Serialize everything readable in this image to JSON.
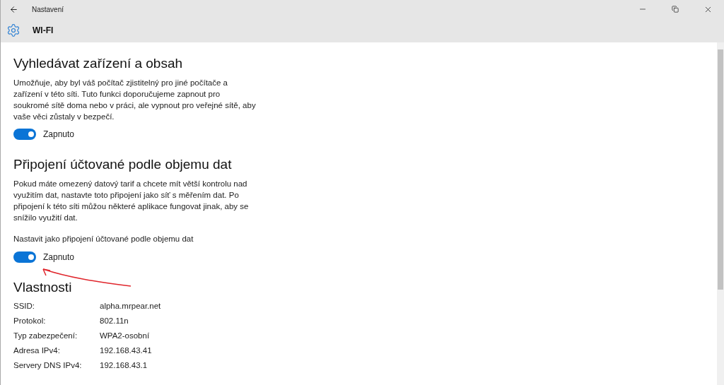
{
  "window": {
    "title": "Nastavení"
  },
  "header": {
    "title": "WI-FI"
  },
  "sections": [
    {
      "heading": "Vyhledávat zařízení a obsah",
      "description": "Umožňuje, aby byl váš počítač zjistitelný pro jiné počítače a zařízení v této síti. Tuto funkci doporučujeme zapnout pro soukromé sítě doma nebo v práci, ale vypnout pro veřejné sítě, aby vaše věci zůstaly v bezpečí.",
      "toggle": {
        "on": true,
        "text": "Zapnuto"
      }
    },
    {
      "heading": "Připojení účtované podle objemu dat",
      "description": "Pokud máte omezený datový tarif a chcete mít větší kontrolu nad využitím dat, nastavte toto připojení jako síť s měřením dat. Po připojení k této síti můžou některé aplikace fungovat jinak, aby se snížilo využití dat.",
      "label": "Nastavit jako připojení účtované podle objemu dat",
      "toggle": {
        "on": true,
        "text": "Zapnuto"
      }
    }
  ],
  "properties": {
    "heading": "Vlastnosti",
    "rows": [
      {
        "label": "SSID:",
        "value": "alpha.mrpear.net"
      },
      {
        "label": "Protokol:",
        "value": "802.11n"
      },
      {
        "label": "Typ zabezpečení:",
        "value": "WPA2-osobní"
      },
      {
        "label": "Adresa IPv4:",
        "value": "192.168.43.41"
      },
      {
        "label": "Servery DNS IPv4:",
        "value": "192.168.43.1"
      }
    ]
  }
}
